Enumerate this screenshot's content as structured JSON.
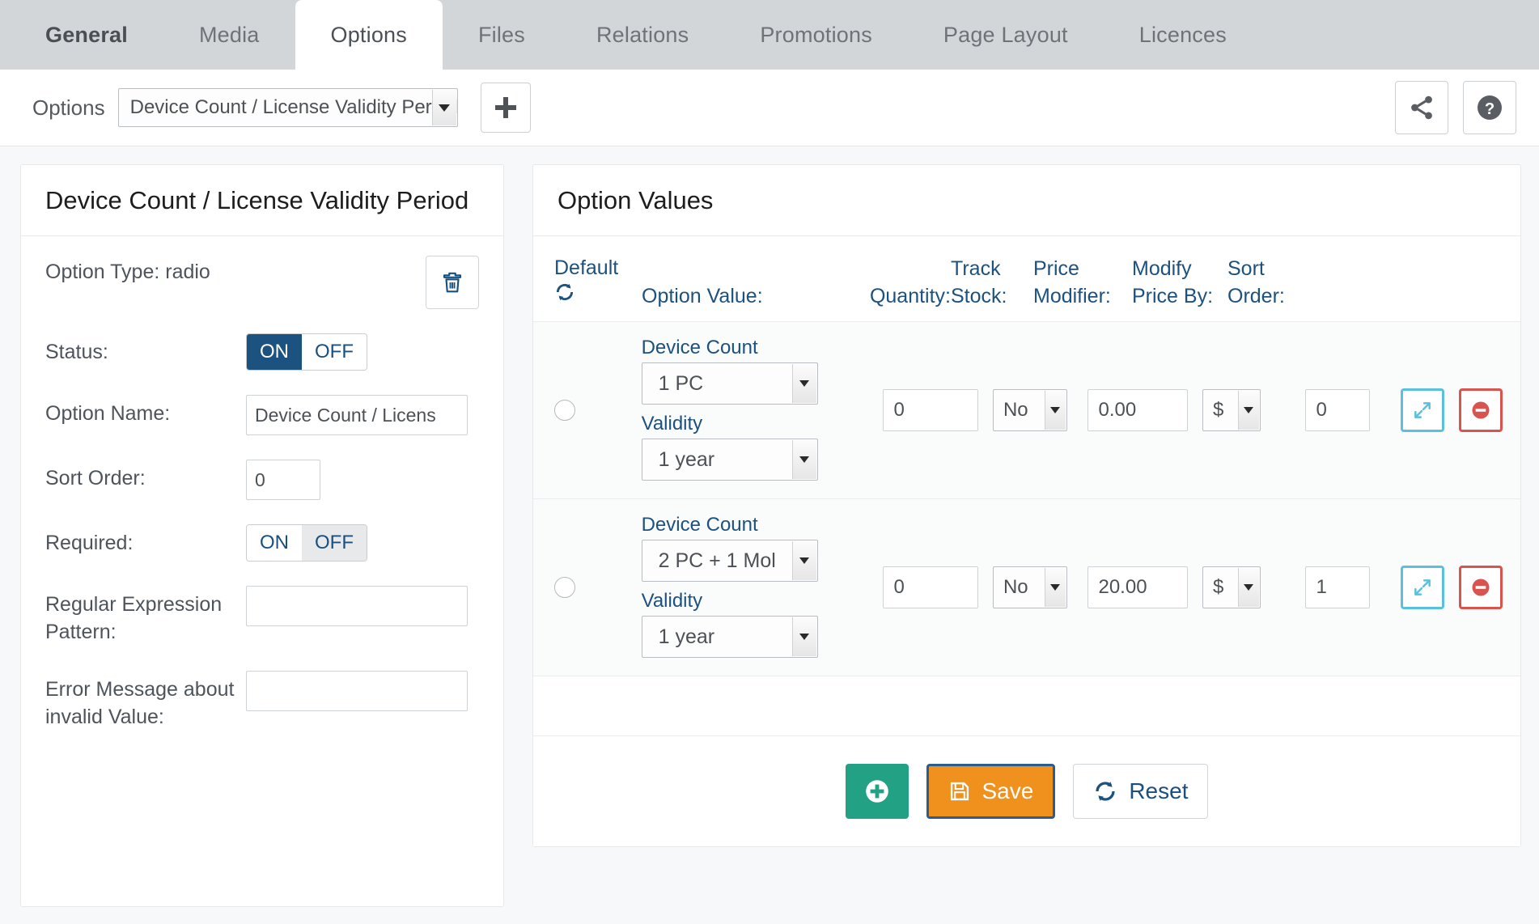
{
  "tabs": [
    {
      "label": "General",
      "active": false,
      "bold": true
    },
    {
      "label": "Media",
      "active": false
    },
    {
      "label": "Options",
      "active": true
    },
    {
      "label": "Files",
      "active": false
    },
    {
      "label": "Relations",
      "active": false
    },
    {
      "label": "Promotions",
      "active": false
    },
    {
      "label": "Page Layout",
      "active": false
    },
    {
      "label": "Licences",
      "active": false
    }
  ],
  "toolbar": {
    "label": "Options",
    "selected_option": "Device Count / License Validity Period",
    "add_button": "add-option",
    "share_icon": "share-icon",
    "help_icon": "help-circle-icon"
  },
  "left_panel": {
    "title": "Device Count / License Validity Period",
    "option_type": "Option Type: radio",
    "delete_icon": "trash-icon",
    "fields": {
      "status_label": "Status:",
      "status_on": "ON",
      "status_off": "OFF",
      "status_value": "ON",
      "name_label": "Option Name:",
      "name_value": "Device Count / Licens",
      "sort_label": "Sort Order:",
      "sort_value": "0",
      "required_label": "Required:",
      "required_on": "ON",
      "required_off": "OFF",
      "required_value": "OFF",
      "regex_label": "Regular Expression Pattern:",
      "regex_value": "",
      "error_label": "Error Message about invalid Value:",
      "error_value": ""
    }
  },
  "right_panel": {
    "title": "Option Values",
    "columns": {
      "default_top": "Default",
      "default_icon": "refresh-icon",
      "option_value": "Option Value:",
      "quantity_top": "",
      "quantity": "Quantity:",
      "track_top": "Track",
      "stock": "Stock:",
      "price_top": "Price",
      "modifier": "Modifier:",
      "modify_top": "Modify",
      "price_by": "Price By:",
      "sort_top": "Sort",
      "sort_order": "Order:"
    },
    "rows": [
      {
        "default_selected": false,
        "device_count_label": "Device Count",
        "device_count_value": "1 PC",
        "validity_label": "Validity",
        "validity_value": "1 year",
        "quantity": "0",
        "track_stock": "No",
        "price_modifier": "0.00",
        "modify_price_by": "$",
        "sort_order": "0",
        "expand_icon": "expand-arrows-icon",
        "remove_icon": "minus-circle-icon"
      },
      {
        "default_selected": false,
        "device_count_label": "Device Count",
        "device_count_value": "2 PC + 1 Mol",
        "validity_label": "Validity",
        "validity_value": "1 year",
        "quantity": "0",
        "track_stock": "No",
        "price_modifier": "20.00",
        "modify_price_by": "$",
        "sort_order": "1",
        "expand_icon": "expand-arrows-icon",
        "remove_icon": "minus-circle-icon"
      }
    ],
    "footer": {
      "add_icon": "plus-circle-icon",
      "save_label": "Save",
      "save_icon": "floppy-disk-icon",
      "reset_label": "Reset",
      "reset_icon": "refresh-icon"
    }
  },
  "colors": {
    "tabbar_bg": "#d2d6d9",
    "accent_blue": "#1c5180",
    "toggle_on": "#1b527f",
    "save_orange": "#f0911e",
    "add_green": "#22a185",
    "expand_blue": "#5bc0de",
    "remove_red": "#d9534f"
  }
}
